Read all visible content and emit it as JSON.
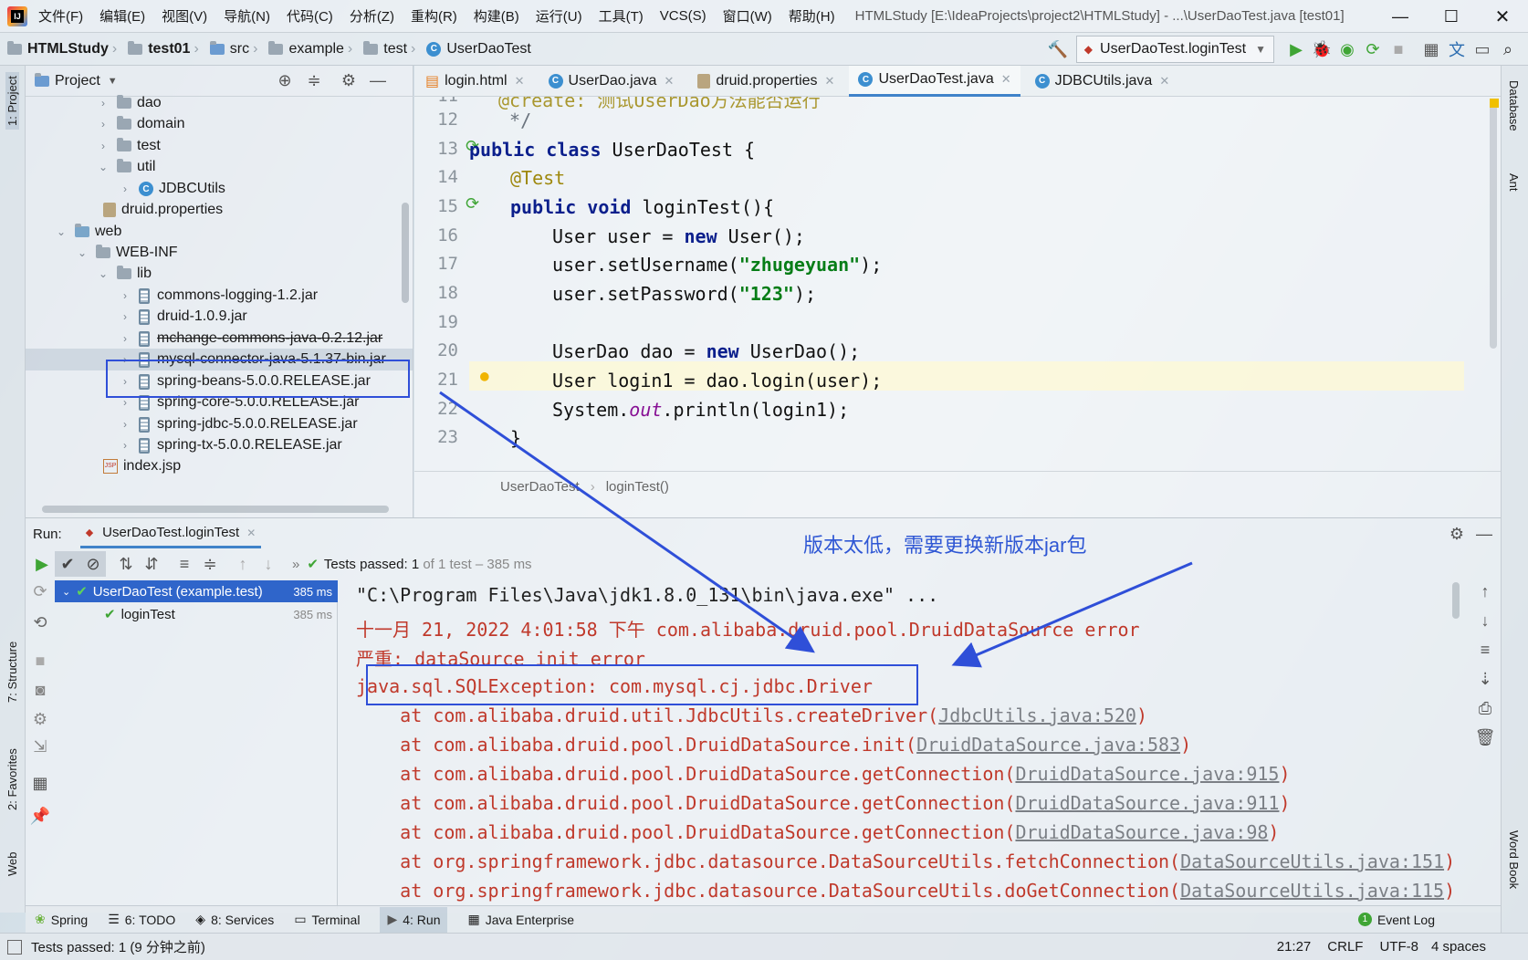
{
  "window": {
    "title": "HTMLStudy [E:\\IdeaProjects\\project2\\HTMLStudy] - ...\\UserDaoTest.java [test01]"
  },
  "menu": [
    "文件(F)",
    "编辑(E)",
    "视图(V)",
    "导航(N)",
    "代码(C)",
    "分析(Z)",
    "重构(R)",
    "构建(B)",
    "运行(U)",
    "工具(T)",
    "VCS(S)",
    "窗口(W)",
    "帮助(H)"
  ],
  "breadcrumbs": [
    "HTMLStudy",
    "test01",
    "src",
    "example",
    "test",
    "UserDaoTest"
  ],
  "run_config": "UserDaoTest.loginTest",
  "project_panel": {
    "title": "Project",
    "items": [
      "dao",
      "domain",
      "test",
      "util",
      "JDBCUtils",
      "druid.properties",
      "web",
      "WEB-INF",
      "lib",
      "commons-logging-1.2.jar",
      "druid-1.0.9.jar",
      "mchange-commons-java-0.2.12.jar",
      "mysql-connector-java-5.1.37-bin.jar",
      "spring-beans-5.0.0.RELEASE.jar",
      "spring-core-5.0.0.RELEASE.jar",
      "spring-jdbc-5.0.0.RELEASE.jar",
      "spring-tx-5.0.0.RELEASE.jar",
      "index.jsp"
    ]
  },
  "editor_tabs": [
    "login.html",
    "UserDao.java",
    "druid.properties",
    "UserDaoTest.java",
    "JDBCUtils.java"
  ],
  "editor": {
    "line_numbers": [
      "11",
      "12",
      "13",
      "14",
      "15",
      "16",
      "17",
      "18",
      "19",
      "20",
      "21",
      "22",
      "23"
    ],
    "partial_top": "@create: 测试UserDao方法能否运行",
    "comment_end": "*/",
    "kw_public": "public",
    "kw_class": "class",
    "class_name": " UserDaoTest {",
    "annotation": "@Test",
    "kw_void": "void",
    "method_decl": " loginTest(){",
    "l16a": "User user = ",
    "kw_new": "new",
    "l16b": " User();",
    "l17a": "user.setUsername(",
    "l17s": "\"zhugeyuan\"",
    "l17b": ");",
    "l18a": "user.setPassword(",
    "l18s": "\"123\"",
    "l18b": ");",
    "l20a": "UserDao dao = ",
    "l20b": " UserDao();",
    "l21": "User login1 = dao.login(user);",
    "l22a": "System.",
    "l22out": "out",
    "l22b": ".println(login1);",
    "l23": "}",
    "breadcrumb": [
      "UserDaoTest",
      "loginTest()"
    ]
  },
  "run": {
    "label": "Run:",
    "tab": "UserDaoTest.loginTest",
    "tests_passed_prefix": "Tests passed: ",
    "tests_passed_count": "1",
    "tests_passed_suffix": "of 1 test – 385 ms",
    "tree": [
      {
        "name": "UserDaoTest (example.test)",
        "time": "385 ms"
      },
      {
        "name": "loginTest",
        "time": "385 ms"
      }
    ],
    "annotation_text": "版本太低，需要更换新版本jar包",
    "console": {
      "line1": "\"C:\\Program Files\\Java\\jdk1.8.0_131\\bin\\java.exe\" ...",
      "line2": "十一月 21, 2022 4:01:58 下午 com.alibaba.druid.pool.DruidDataSource error",
      "line3": "严重: dataSource init error",
      "line4": "java.sql.SQLException: com.mysql.cj.jdbc.Driver",
      "stack": [
        {
          "text": "    at com.alibaba.druid.util.JdbcUtils.createDriver(",
          "link": "JdbcUtils.java:520",
          "end": ")"
        },
        {
          "text": "    at com.alibaba.druid.pool.DruidDataSource.init(",
          "link": "DruidDataSource.java:583",
          "end": ")"
        },
        {
          "text": "    at com.alibaba.druid.pool.DruidDataSource.getConnection(",
          "link": "DruidDataSource.java:915",
          "end": ")"
        },
        {
          "text": "    at com.alibaba.druid.pool.DruidDataSource.getConnection(",
          "link": "DruidDataSource.java:911",
          "end": ")"
        },
        {
          "text": "    at com.alibaba.druid.pool.DruidDataSource.getConnection(",
          "link": "DruidDataSource.java:98",
          "end": ")"
        },
        {
          "text": "    at org.springframework.jdbc.datasource.DataSourceUtils.fetchConnection(",
          "link": "DataSourceUtils.java:151",
          "end": ")"
        },
        {
          "text": "    at org.springframework.jdbc.datasource.DataSourceUtils.doGetConnection(",
          "link": "DataSourceUtils.java:115",
          "end": ")"
        }
      ]
    }
  },
  "bottom_tools": [
    "Spring",
    "6: TODO",
    "8: Services",
    "Terminal",
    "4: Run",
    "Java Enterprise"
  ],
  "event_log": "Event Log",
  "status": {
    "message": "Tests passed: 1 (9 分钟之前)",
    "position": "21:27",
    "line_sep": "CRLF",
    "encoding": "UTF-8",
    "indent": "4 spaces"
  },
  "left_strip": [
    "1: Project",
    "7: Structure",
    "2: Favorites",
    "Web"
  ],
  "right_strip": [
    "Database",
    "Ant",
    "Word Book"
  ],
  "colors": {
    "accent": "#4083c9",
    "highlight_box": "#2f4fd8",
    "error": "#c0392b",
    "pass": "#3fa535"
  }
}
